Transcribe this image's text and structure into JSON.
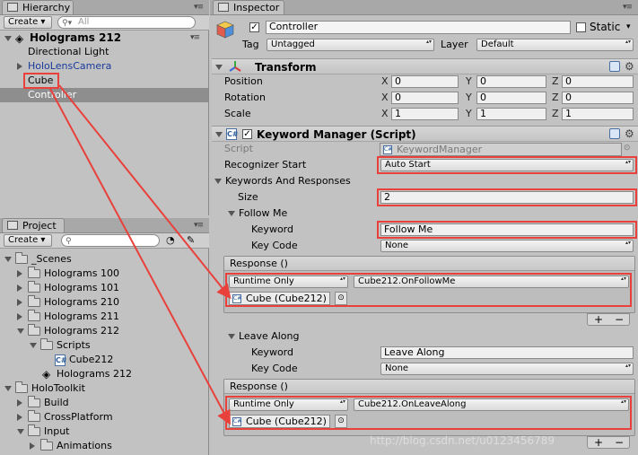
{
  "hierarchy": {
    "tab_title": "Hierarchy",
    "create_label": "Create",
    "search_placeholder": "All",
    "scene_name": "Holograms 212",
    "items": [
      {
        "label": "Directional Light"
      },
      {
        "label": "HoloLensCamera"
      },
      {
        "label": "Cube"
      },
      {
        "label": "Controller"
      }
    ]
  },
  "project": {
    "tab_title": "Project",
    "create_label": "Create",
    "items": [
      {
        "label": "_Scenes"
      },
      {
        "label": "Holograms 100"
      },
      {
        "label": "Holograms 101"
      },
      {
        "label": "Holograms 210"
      },
      {
        "label": "Holograms 211"
      },
      {
        "label": "Holograms 212"
      },
      {
        "label": "Scripts"
      },
      {
        "label": "Cube212"
      },
      {
        "label": "Holograms 212"
      },
      {
        "label": "HoloToolkit"
      },
      {
        "label": "Build"
      },
      {
        "label": "CrossPlatform"
      },
      {
        "label": "Input"
      },
      {
        "label": "Animations"
      }
    ]
  },
  "inspector": {
    "tab_title": "Inspector",
    "object_name": "Controller",
    "static_label": "Static",
    "tag_label": "Tag",
    "tag_value": "Untagged",
    "layer_label": "Layer",
    "layer_value": "Default",
    "transform": {
      "title": "Transform",
      "position_label": "Position",
      "rotation_label": "Rotation",
      "scale_label": "Scale",
      "x": "X",
      "y": "Y",
      "z": "Z",
      "position": [
        "0",
        "0",
        "0"
      ],
      "rotation": [
        "0",
        "0",
        "0"
      ],
      "scale": [
        "1",
        "1",
        "1"
      ]
    },
    "keyword_manager": {
      "title": "Keyword Manager (Script)",
      "script_label": "Script",
      "script_value": "KeywordManager",
      "recognizer_label": "Recognizer Start",
      "recognizer_value": "Auto Start",
      "kar_label": "Keywords And Responses",
      "size_label": "Size",
      "size_value": "2",
      "entries": [
        {
          "header": "Follow Me",
          "keyword_label": "Keyword",
          "keyword_value": "Follow Me",
          "keycode_label": "Key Code",
          "keycode_value": "None",
          "response_label": "Response ()",
          "runtime_value": "Runtime Only",
          "function_value": "Cube212.OnFollowMe",
          "object_value": "Cube (Cube212)"
        },
        {
          "header": "Leave Along",
          "keyword_label": "Keyword",
          "keyword_value": "Leave Along",
          "keycode_label": "Key Code",
          "keycode_value": "None",
          "response_label": "Response ()",
          "runtime_value": "Runtime Only",
          "function_value": "Cube212.OnLeaveAlong",
          "object_value": "Cube (Cube212)"
        }
      ]
    },
    "plus_label": "+",
    "minus_label": "−",
    "watermark": "http://blog.csdn.net/u0123456789"
  }
}
